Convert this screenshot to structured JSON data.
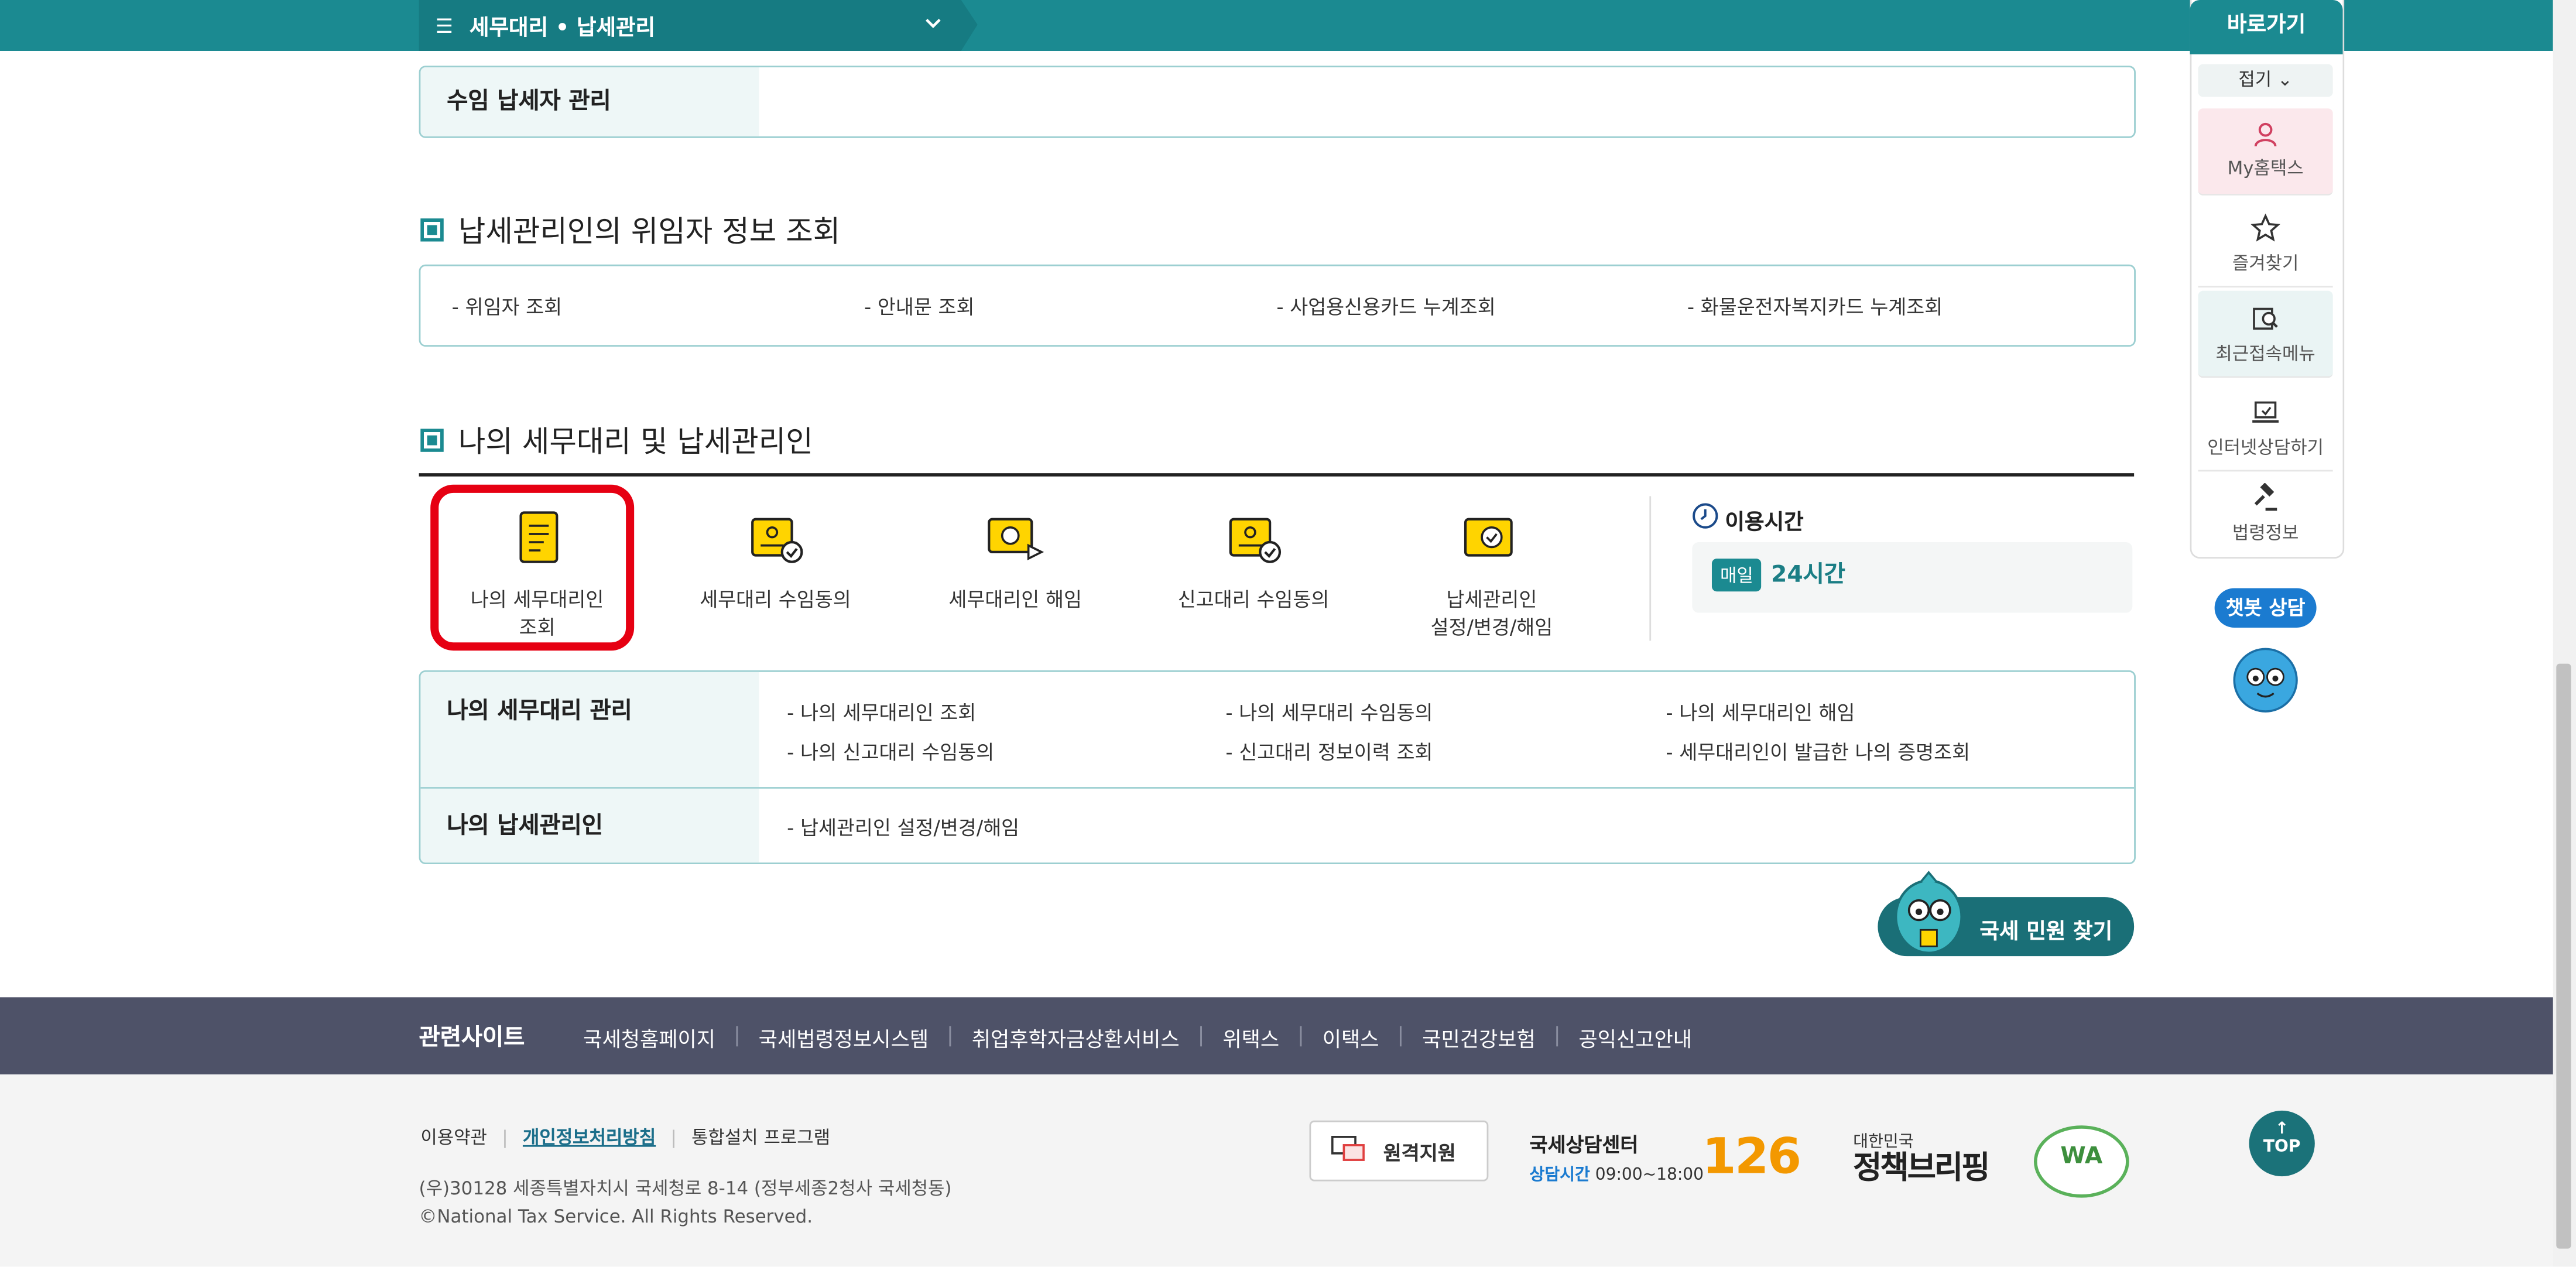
{
  "topbar": {
    "menu_title": "세무대리 • 납세관리"
  },
  "managed_taxpayers": {
    "label": "수임 납세자 관리"
  },
  "section_delegator": {
    "title": "납세관리인의 위임자 정보 조회",
    "links": [
      "- 위임자 조회",
      "- 안내문 조회",
      "- 사업용신용카드 누계조회",
      "- 화물운전자복지카드 누계조회"
    ]
  },
  "section_my_agent": {
    "title": "나의 세무대리 및 납세관리인",
    "services": [
      {
        "label_line1": "나의 세무대리인",
        "label_line2": "조회"
      },
      {
        "label_line1": "세무대리 수임동의",
        "label_line2": ""
      },
      {
        "label_line1": "세무대리인 해임",
        "label_line2": ""
      },
      {
        "label_line1": "신고대리 수임동의",
        "label_line2": ""
      },
      {
        "label_line1": "납세관리인",
        "label_line2": "설정/변경/해임"
      }
    ],
    "hours": {
      "title": "이용시간",
      "badge": "매일",
      "value": "24시간"
    },
    "rows": [
      {
        "label": "나의 세무대리 관리",
        "links": [
          "- 나의 세무대리인 조회",
          "- 나의 세무대리 수임동의",
          "- 나의 세무대리인 해임",
          "- 나의 신고대리 수임동의",
          "- 신고대리 정보이력 조회",
          "- 세무대리인이 발급한 나의 증명조회"
        ]
      },
      {
        "label": "나의 납세관리인",
        "links": [
          "- 납세관리인 설정/변경/해임"
        ]
      }
    ]
  },
  "find_button": "국세 민원 찾기",
  "quick_menu": {
    "title": "바로가기",
    "fold": "접기",
    "items": [
      "My홈택스",
      "즐겨찾기",
      "최근접속메뉴",
      "인터넷상담하기",
      "법령정보"
    ],
    "chatbot": "챗봇 상담"
  },
  "footer": {
    "related_title": "관련사이트",
    "related_links": [
      "국세청홈페이지",
      "국세법령정보시스템",
      "취업후학자금상환서비스",
      "위택스",
      "이택스",
      "국민건강보험",
      "공익신고안내"
    ],
    "links": [
      "이용약관",
      "개인정보처리방침",
      "통합설치 프로그램"
    ],
    "address": "(우)30128 세종특별자치시 국세청로 8-14 (정부세종2청사 국세청동)",
    "copyright": "©National Tax Service. All Rights Reserved.",
    "remote": "원격지원",
    "center_title": "국세상담센터",
    "center_hours_label": "상담시간",
    "center_hours": "09:00~18:00",
    "center_number": "126",
    "policy_small": "대한민국",
    "policy_big": "정책브리핑",
    "wa_mark": "WA",
    "top": "TOP"
  },
  "colors": {
    "primary": "#1b8a91",
    "footer_dark": "#4e5268",
    "highlight": "#e60012"
  }
}
